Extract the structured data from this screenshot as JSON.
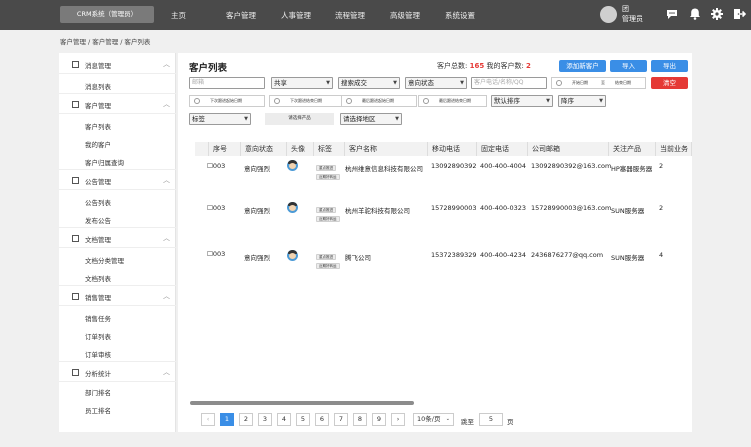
{
  "topbar": {
    "brand": "CRM系统（管理员）",
    "nav": [
      "主页",
      "客户管理",
      "人事管理",
      "流程管理",
      "高级管理",
      "系统设置"
    ],
    "user_name": "团",
    "user_role": "管理员",
    "icons": [
      "chat-icon",
      "bell-icon",
      "gear-icon",
      "logout-icon"
    ]
  },
  "breadcrumb": [
    "客户管理",
    "/",
    "客户管理",
    "/",
    "客户列表"
  ],
  "sidebar": {
    "groups": [
      {
        "label": "消息管理",
        "items": [
          "消息列表"
        ]
      },
      {
        "label": "客户管理",
        "items": [
          "客户列表",
          "我的客户",
          "客户归属查询"
        ]
      },
      {
        "label": "公告管理",
        "items": [
          "公告列表",
          "发布公告"
        ]
      },
      {
        "label": "文档管理",
        "items": [
          "文档分类管理",
          "文档列表"
        ]
      },
      {
        "label": "销售管理",
        "items": [
          "销售任务",
          "订单列表",
          "订单审核"
        ]
      },
      {
        "label": "分析统计",
        "items": [
          "部门排名",
          "员工排名"
        ]
      }
    ]
  },
  "main": {
    "title": "客户列表",
    "total_label": "客户总数:",
    "total_value": "165",
    "mine_label": "我的客户数:",
    "mine_value": "2",
    "buttons": {
      "add": "添加新客户",
      "import": "导入",
      "export": "导出",
      "clear": "清空"
    },
    "colors": {
      "primary": "#3a8ee6",
      "danger": "#e53935"
    },
    "filters": {
      "email_placeholder": "邮箱",
      "share": "共享",
      "deal": "搜索成交",
      "intent": "意向状态",
      "phone_placeholder": "客户电话/名称/QQ",
      "start_date": "开始日期",
      "to": "至",
      "end_date": "结束日期",
      "next_start": "下次跟进起始日期",
      "next_end": "下次跟进结束日期",
      "last_start": "最后跟进起始日期",
      "last_end": "最后跟进结束日期",
      "sort": "默认排序",
      "order": "降序",
      "tags": "标签",
      "product": "请选择产品",
      "region": "请选择地区"
    },
    "table": {
      "headers": [
        "序号",
        "意向状态",
        "头像",
        "标签",
        "客户名称",
        "移动电话",
        "固定电话",
        "公司邮箱",
        "关注产品",
        "当前业务"
      ],
      "rows": [
        {
          "no": "003",
          "intent": "意向强烈",
          "tag1": "重点推进",
          "tag2": "近期好转运",
          "name": "杭州维意信息科技有限公司",
          "mobile": "13092890392",
          "phone": "400-400-4004",
          "email": "13092890392@163.com",
          "product": "HP塞器服务器",
          "biz": "2"
        },
        {
          "no": "003",
          "intent": "意向强烈",
          "tag1": "重点推进",
          "tag2": "近期好转运",
          "name": "杭州羊驼科技有限公司",
          "mobile": "15728990003",
          "phone": "400-400-0323",
          "email": "15728990003@163.com",
          "product": "SUN服务器",
          "biz": "2"
        },
        {
          "no": "003",
          "intent": "意向强烈",
          "tag1": "重点推进",
          "tag2": "近期好转运",
          "name": "腾飞公司",
          "mobile": "15372389329",
          "phone": "400-400-4234",
          "email": "2436876277@qq.com",
          "product": "SUN服务器",
          "biz": "4"
        }
      ]
    },
    "pagination": {
      "prev": "‹",
      "next": "›",
      "pages": [
        "1",
        "2",
        "3",
        "4",
        "5",
        "6",
        "7",
        "8",
        "9"
      ],
      "current": "1",
      "page_size": "10条/页",
      "goto_label": "跳至",
      "goto_value": "5",
      "page_suffix": "页"
    }
  }
}
